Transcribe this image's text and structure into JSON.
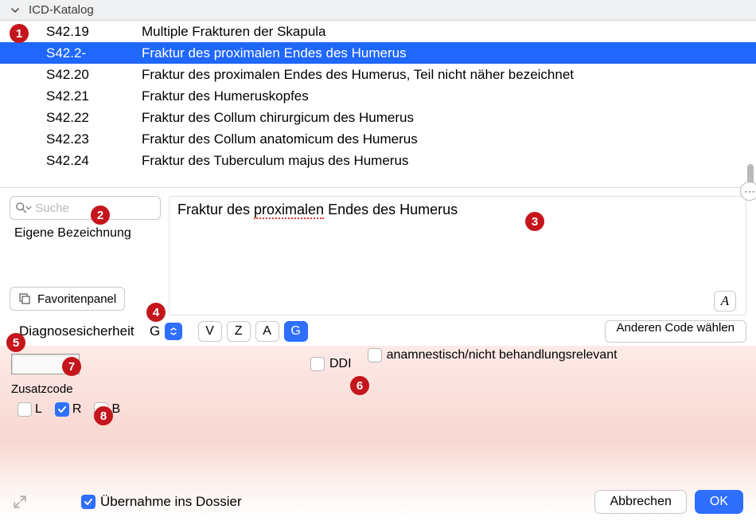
{
  "titlebar": {
    "label": "ICD-Katalog"
  },
  "list": {
    "rows": [
      {
        "code": "S42.19",
        "desc": "Multiple Frakturen der Skapula",
        "selected": false
      },
      {
        "code": "S42.2-",
        "desc": "Fraktur des proximalen Endes des Humerus",
        "selected": true
      },
      {
        "code": "S42.20",
        "desc": "Fraktur des proximalen Endes des Humerus, Teil nicht näher bezeichnet",
        "selected": false
      },
      {
        "code": "S42.21",
        "desc": "Fraktur des Humeruskopfes",
        "selected": false
      },
      {
        "code": "S42.22",
        "desc": "Fraktur des Collum chirurgicum des Humerus",
        "selected": false
      },
      {
        "code": "S42.23",
        "desc": "Fraktur des Collum anatomicum des Humerus",
        "selected": false
      },
      {
        "code": "S42.24",
        "desc": "Fraktur des Tuberculum majus des Humerus",
        "selected": false
      }
    ]
  },
  "search": {
    "placeholder": "Suche"
  },
  "eigene_label": "Eigene Bezeichnung",
  "fav_label": "Favoritenpanel",
  "description": {
    "before": "Fraktur des ",
    "spell": "proximalen",
    "after": " Endes des Humerus"
  },
  "diag": {
    "label": "Diagnosesicherheit",
    "value": "G",
    "options": [
      "V",
      "Z",
      "A",
      "G"
    ],
    "active": "G",
    "other_code": "Anderen Code wählen"
  },
  "lower": {
    "ddi_label": "DDI",
    "anam_label": "anamnestisch/nicht behandlungsrelevant",
    "zusatz_label": "Zusatzcode",
    "lrb": [
      {
        "key": "L",
        "checked": false
      },
      {
        "key": "R",
        "checked": true
      },
      {
        "key": "B",
        "checked": false
      }
    ]
  },
  "footer": {
    "dossier_label": "Übernahme ins Dossier",
    "cancel": "Abbrechen",
    "ok": "OK"
  },
  "badges": {
    "1": "1",
    "2": "2",
    "3": "3",
    "4": "4",
    "5": "5",
    "6": "6",
    "7": "7",
    "8": "8"
  }
}
